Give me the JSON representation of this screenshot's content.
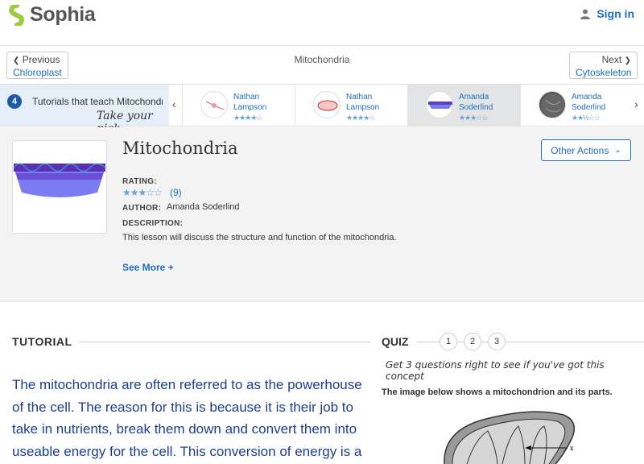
{
  "header": {
    "logo": "Sophia",
    "signin": "Sign in"
  },
  "nav": {
    "prev_label": "Previous",
    "prev_topic": "Chloroplast",
    "title": "Mitochondria",
    "next_label": "Next",
    "next_topic": "Cytoskeleton"
  },
  "strip": {
    "count": "4",
    "title": "Tutorials that teach Mitochondria",
    "pick": "Take your pick:",
    "cards": [
      {
        "author_first": "Nathan",
        "author_last": "Lampson",
        "stars": "★★★★☆",
        "rating": 4
      },
      {
        "author_first": "Nathan",
        "author_last": "Lampson",
        "stars": "★★★★☆",
        "rating": 4
      },
      {
        "author_first": "Amanda",
        "author_last": "Soderlind",
        "stars": "★★★☆☆",
        "rating": 3
      },
      {
        "author_first": "Amanda",
        "author_last": "Soderlind",
        "stars": "★★½☆☆",
        "rating": 2.5
      }
    ]
  },
  "lesson": {
    "title": "Mitochondria",
    "other_actions": "Other Actions",
    "rating_label": "RATING:",
    "rating_stars": "★★★☆☆",
    "rating_count": "(9)",
    "author_label": "AUTHOR:",
    "author": "Amanda Soderlind",
    "description_label": "DESCRIPTION:",
    "description": "This lesson will discuss the structure and function of the mitochondria.",
    "see_more": "See More +"
  },
  "tutorial": {
    "heading": "TUTORIAL",
    "lines": [
      "The mitochondria are often referred to as the powerhouse",
      "of the cell. The reason for this is because it is their job to",
      "take in nutrients, break them down and convert them into",
      "useable energy for the cell.  This conversion of energy is a"
    ]
  },
  "quiz": {
    "heading": "QUIZ",
    "numbers": [
      "1",
      "2",
      "3"
    ],
    "prompt": "Get 3 questions right to see if you've got this concept",
    "question": "The image below shows a mitochondrion and its parts.",
    "diagram_label": "x"
  },
  "colors": {
    "accent": "#1f6fbe",
    "logo_green": "#9ccb3b",
    "text_blue": "#1c3f94"
  }
}
